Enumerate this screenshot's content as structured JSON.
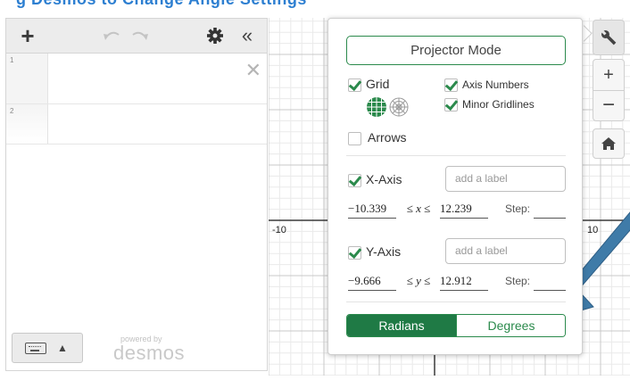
{
  "colors": {
    "accent": "#2b8a4c",
    "accent_dark": "#1f7a45",
    "grid_minor": "#eaeaea",
    "grid_major": "#c8c8c8",
    "axis": "#3a3a3a",
    "arrow": "#3f7ba8"
  },
  "banner": {
    "text": "g  Desmos  to  Change  Angle  Settings"
  },
  "toolbar": {
    "add_icon": "plus-icon",
    "undo_icon": "undo-icon",
    "redo_icon": "redo-icon",
    "settings_icon": "gear-icon",
    "collapse_icon": "double-chevron-left-icon"
  },
  "expressions": [
    {
      "index": "1"
    },
    {
      "index": "2"
    }
  ],
  "keyboard": {
    "icon": "keyboard-icon",
    "caret": "▲"
  },
  "branding": {
    "powered_by": "powered by",
    "logo": "desmos"
  },
  "graph": {
    "left_label": "-10",
    "right_label": "10"
  },
  "side_controls": {
    "wrench_icon": "wrench-icon",
    "zoom_in": "+",
    "zoom_out": "−",
    "home_icon": "home-icon"
  },
  "settings": {
    "projector_mode": "Projector Mode",
    "grid": {
      "label": "Grid",
      "checked": true
    },
    "axis_numbers": {
      "label": "Axis Numbers",
      "checked": true
    },
    "minor_gridlines": {
      "label": "Minor Gridlines",
      "checked": true
    },
    "arrows": {
      "label": "Arrows",
      "checked": false
    },
    "x_axis": {
      "label": "X-Axis",
      "checked": true,
      "placeholder": "add a label",
      "min": "−10.339",
      "expr": "≤ x ≤",
      "max": "12.239",
      "step_label": "Step:"
    },
    "y_axis": {
      "label": "Y-Axis",
      "checked": true,
      "placeholder": "add a label",
      "min": "−9.666",
      "expr": "≤ y ≤",
      "max": "12.912",
      "step_label": "Step:"
    },
    "angle_units": {
      "radians": "Radians",
      "degrees": "Degrees",
      "selected": "radians"
    }
  }
}
